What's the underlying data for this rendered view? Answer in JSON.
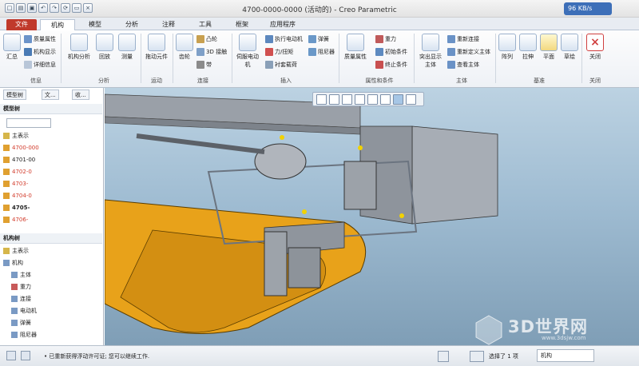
{
  "window": {
    "title": "4700-0000-0000 (活动的) - Creo Parametric",
    "speed": "96 KB/s"
  },
  "tabs": [
    "文件",
    "机构",
    "模型",
    "分析",
    "注释",
    "工具",
    "框架",
    "应用程序"
  ],
  "ribbon": {
    "info": {
      "label": "信息",
      "summary": "汇总",
      "mass_props": "质量属性",
      "mech_display": "机构显示",
      "details": "详细信息"
    },
    "analysis": {
      "label": "分析",
      "mech_analysis": "机构分析",
      "playback": "回放",
      "measure": "测量"
    },
    "motion": {
      "label": "运动",
      "drag": "拖动元件"
    },
    "connect": {
      "label": "连接",
      "gear": "齿轮",
      "cam": "凸轮",
      "joint3d": "3D 接触",
      "belt": "带"
    },
    "insert": {
      "label": "插入",
      "servo": "伺服电动机",
      "exec_motor": "执行电动机",
      "spring": "弹簧",
      "force": "力/扭矩",
      "damper": "阻尼器",
      "bushing": "衬套载荷"
    },
    "props": {
      "label": "属性和条件",
      "mass": "质量属性",
      "gravity": "重力",
      "init": "初始条件",
      "term": "终止条件"
    },
    "body": {
      "label": "主体",
      "highlight": "突出显示主体",
      "reconnect": "重新连接",
      "redefine": "重新定义主体",
      "view": "查看主体"
    },
    "datum": {
      "label": "基准",
      "pattern": "阵列",
      "extrude": "拉伸",
      "plane": "平面",
      "sketch": "草绘"
    },
    "close": {
      "label": "关闭",
      "close": "关闭"
    }
  },
  "panel": {
    "tabs": [
      "模型树",
      "文...",
      "收..."
    ],
    "model_tree": "模型树",
    "main_rep": "主表示",
    "parts": [
      "4700-000",
      "4701-00",
      "4702-0",
      "4703-",
      "4704-0",
      "4705-",
      "4706-"
    ],
    "mech_tree": "机构树",
    "mech_rep": "主表示",
    "mech_items": [
      "机构",
      "主体",
      "重力",
      "连接",
      "电动机",
      "弹簧",
      "阻尼器"
    ]
  },
  "status": {
    "message": "• 已重新获得浮动许可证; 您可以继续工作.",
    "selection": "选择了 1 项",
    "filter": "机构"
  },
  "watermark": {
    "text": "3D世界网",
    "url": "www.3dsjw.com"
  }
}
